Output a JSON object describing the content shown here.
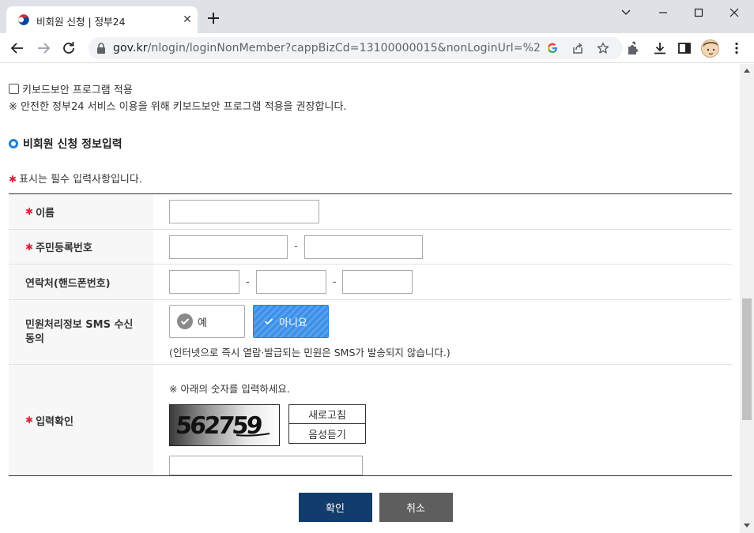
{
  "browser": {
    "tab_title": "비회원 신청 | 정부24",
    "url_host": "gov.kr",
    "url_path": "/nlogin/loginNonMember?cappBizCd=13100000015&nonLoginUrl=%2Fmw...",
    "icons": [
      "close-icon",
      "plus-icon",
      "chevron-down-icon",
      "minimize-icon",
      "maximize-icon",
      "window-close-icon",
      "back-arrow-icon",
      "forward-arrow-icon",
      "reload-icon",
      "lock-icon",
      "google-icon",
      "share-icon",
      "star-icon",
      "extensions-icon",
      "download-icon",
      "side-panel-icon",
      "more-icon"
    ]
  },
  "keyboard_security": {
    "checkbox_label": "키보드보안 프로그램 적용",
    "checked": false,
    "note": "※ 안전한 정부24 서비스 이용을 위해 키보드보안 프로그램 적용을 권장합니다."
  },
  "section": {
    "title": "비회원 신청 정보입력",
    "required_note": "표시는 필수 입력사항입니다."
  },
  "form": {
    "name_label": "이름",
    "rrn_label": "주민등록번호",
    "phone_label": "연락처(핸드폰번호)",
    "sms_label": "민원처리정보 SMS 수신동의",
    "sms_yes": "예",
    "sms_no": "아니요",
    "sms_selected": "아니요",
    "sms_note": "(인터넷으로 즉시 열람·발급되는 민원은 SMS가 발송되지 않습니다.)",
    "captcha_label": "입력확인",
    "captcha_note": "※ 아래의 숫자를 입력하세요.",
    "captcha_text": "562759",
    "refresh_label": "새로고침",
    "audio_label": "음성듣기",
    "separator": "-"
  },
  "actions": {
    "confirm": "확인",
    "cancel": "취소"
  },
  "colors": {
    "required_star": "#d6233b",
    "section_ring": "#1e7fd8",
    "confirm_bg": "#123c6b",
    "cancel_bg": "#5e5e5e",
    "selected_bg": "#3b8fe6"
  }
}
